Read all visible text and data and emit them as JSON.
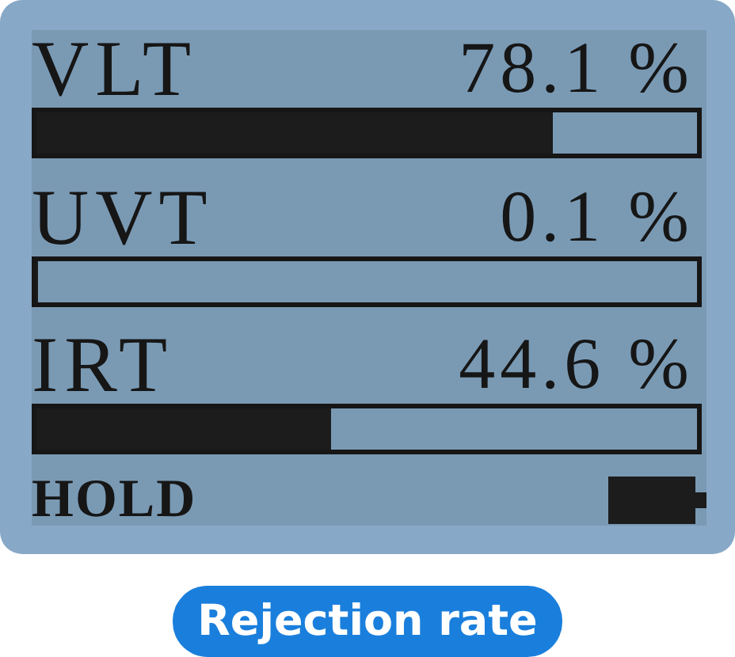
{
  "channels": [
    {
      "name": "VLT",
      "reading": "78.1 %",
      "level": 0.781
    },
    {
      "name": "UVT",
      "reading": "0.1 %",
      "level": 0.001
    },
    {
      "name": "IRT",
      "reading": "44.6 %",
      "level": 0.446
    }
  ],
  "status": "HOLD",
  "caption": "Rejection rate"
}
